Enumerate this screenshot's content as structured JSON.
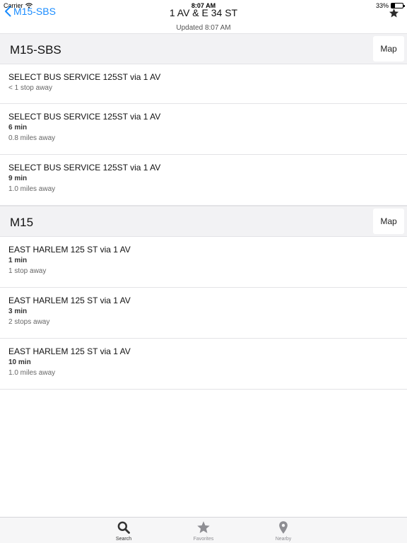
{
  "status_bar": {
    "carrier": "Carrier",
    "time": "8:07 AM",
    "battery": "33%",
    "battery_level": 0.33
  },
  "nav": {
    "back_label": "M15-SBS",
    "title": "1 AV & E 34 ST",
    "subtitle": "Updated 8:07 AM"
  },
  "sections": [
    {
      "title": "M15-SBS",
      "map_label": "Map",
      "rows": [
        {
          "title": "SELECT BUS SERVICE 125ST via 1 AV",
          "time": "",
          "distance": "< 1 stop away"
        },
        {
          "title": "SELECT BUS SERVICE 125ST via 1 AV",
          "time": "6 min",
          "distance": "0.8 miles away"
        },
        {
          "title": "SELECT BUS SERVICE 125ST via 1 AV",
          "time": "9 min",
          "distance": "1.0 miles away"
        }
      ]
    },
    {
      "title": "M15",
      "map_label": "Map",
      "rows": [
        {
          "title": "EAST HARLEM 125 ST via 1 AV",
          "time": "1 min",
          "distance": "1 stop away"
        },
        {
          "title": "EAST HARLEM 125 ST via 1 AV",
          "time": "3 min",
          "distance": "2 stops away"
        },
        {
          "title": "EAST HARLEM 125 ST via 1 AV",
          "time": "10 min",
          "distance": "1.0 miles away"
        }
      ]
    }
  ],
  "tabs": [
    {
      "label": "Search",
      "icon": "search-icon"
    },
    {
      "label": "Favorites",
      "icon": "star-icon"
    },
    {
      "label": "Nearby",
      "icon": "location-pin-icon"
    }
  ],
  "colors": {
    "accent": "#1a8cff",
    "tab_inactive": "#8e8e93",
    "tab_active": "#333333"
  }
}
